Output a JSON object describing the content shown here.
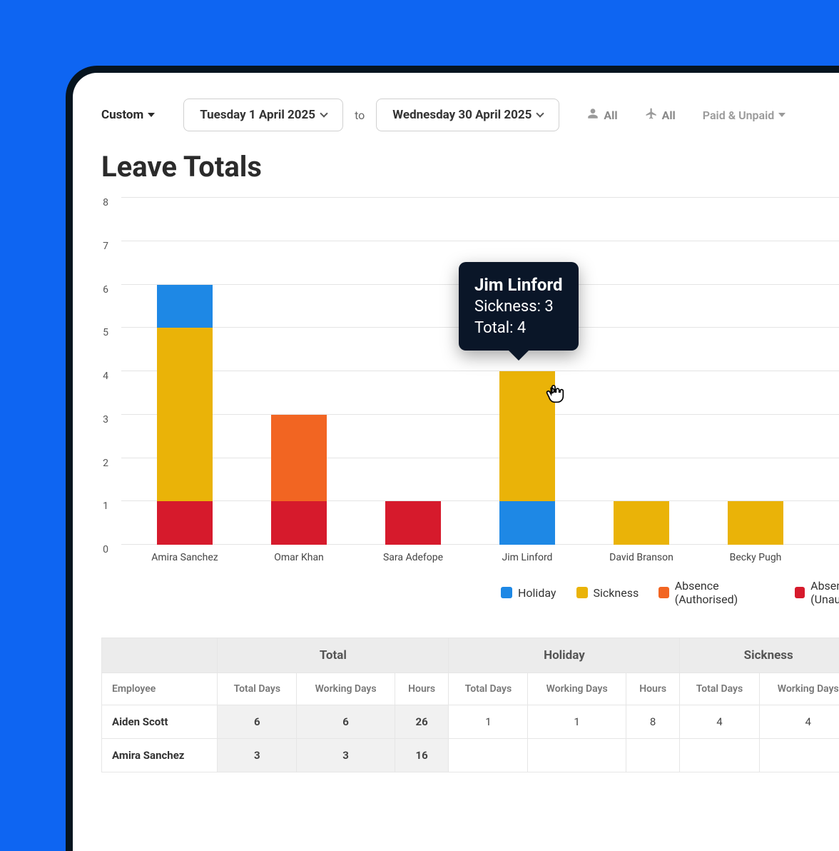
{
  "filters": {
    "range_label": "Custom",
    "date_from": "Tuesday 1 April 2025",
    "to_label": "to",
    "date_to": "Wednesday 30 April 2025",
    "people_filter": "All",
    "type_filter": "All",
    "paid_filter": "Paid & Unpaid"
  },
  "page_title": "Leave Totals",
  "chart_data": {
    "type": "bar",
    "stacked": true,
    "ylabel": "",
    "xlabel": "",
    "ylim": [
      0,
      8
    ],
    "yticks": [
      0,
      1,
      2,
      3,
      4,
      5,
      6,
      7,
      8
    ],
    "categories": [
      "Amira Sanchez",
      "Omar Khan",
      "Sara Adefope",
      "Jim Linford",
      "David Branson",
      "Becky Pugh"
    ],
    "stack_order": [
      "Absence (Unauthorised)",
      "Absence (Authorised)",
      "Sickness",
      "Holiday"
    ],
    "series": [
      {
        "name": "Holiday",
        "color": "#1e88e5",
        "values": [
          1,
          0,
          0,
          1,
          0,
          0
        ]
      },
      {
        "name": "Sickness",
        "color": "#eab308",
        "values": [
          4,
          0,
          0,
          3,
          1,
          1
        ]
      },
      {
        "name": "Absence (Authorised)",
        "color": "#f26522",
        "values": [
          0,
          2,
          0,
          0,
          0,
          0
        ]
      },
      {
        "name": "Absence (Unauthorised)",
        "color": "#d61a2c",
        "values": [
          1,
          1,
          1,
          0,
          0,
          0
        ]
      }
    ],
    "totals": [
      6,
      3,
      1,
      4,
      1,
      1
    ]
  },
  "tooltip": {
    "name": "Jim Linford",
    "line1_label": "Sickness",
    "line1_value": "3",
    "line2_label": "Total",
    "line2_value": "4"
  },
  "legend": [
    {
      "key": "holiday",
      "label": "Holiday"
    },
    {
      "key": "sickness",
      "label": "Sickness"
    },
    {
      "key": "absence-auth",
      "label": "Absence (Authorised)"
    },
    {
      "key": "absence-unauth",
      "label": "Absence (Unauthorised)"
    }
  ],
  "table": {
    "group_headers": [
      "",
      "Total",
      "Holiday",
      "Sickness"
    ],
    "sub_headers": [
      "Employee",
      "Total Days",
      "Working Days",
      "Hours",
      "Total Days",
      "Working Days",
      "Hours",
      "Total Days",
      "Working Days"
    ],
    "rows": [
      {
        "employee": "Aiden Scott",
        "total": {
          "td": "6",
          "wd": "6",
          "h": "26"
        },
        "holiday": {
          "td": "1",
          "wd": "1",
          "h": "8"
        },
        "sickness": {
          "td": "4",
          "wd": "4"
        }
      },
      {
        "employee": "Amira Sanchez",
        "total": {
          "td": "3",
          "wd": "3",
          "h": "16"
        },
        "holiday": {
          "td": "",
          "wd": "",
          "h": ""
        },
        "sickness": {
          "td": "",
          "wd": ""
        }
      }
    ]
  }
}
